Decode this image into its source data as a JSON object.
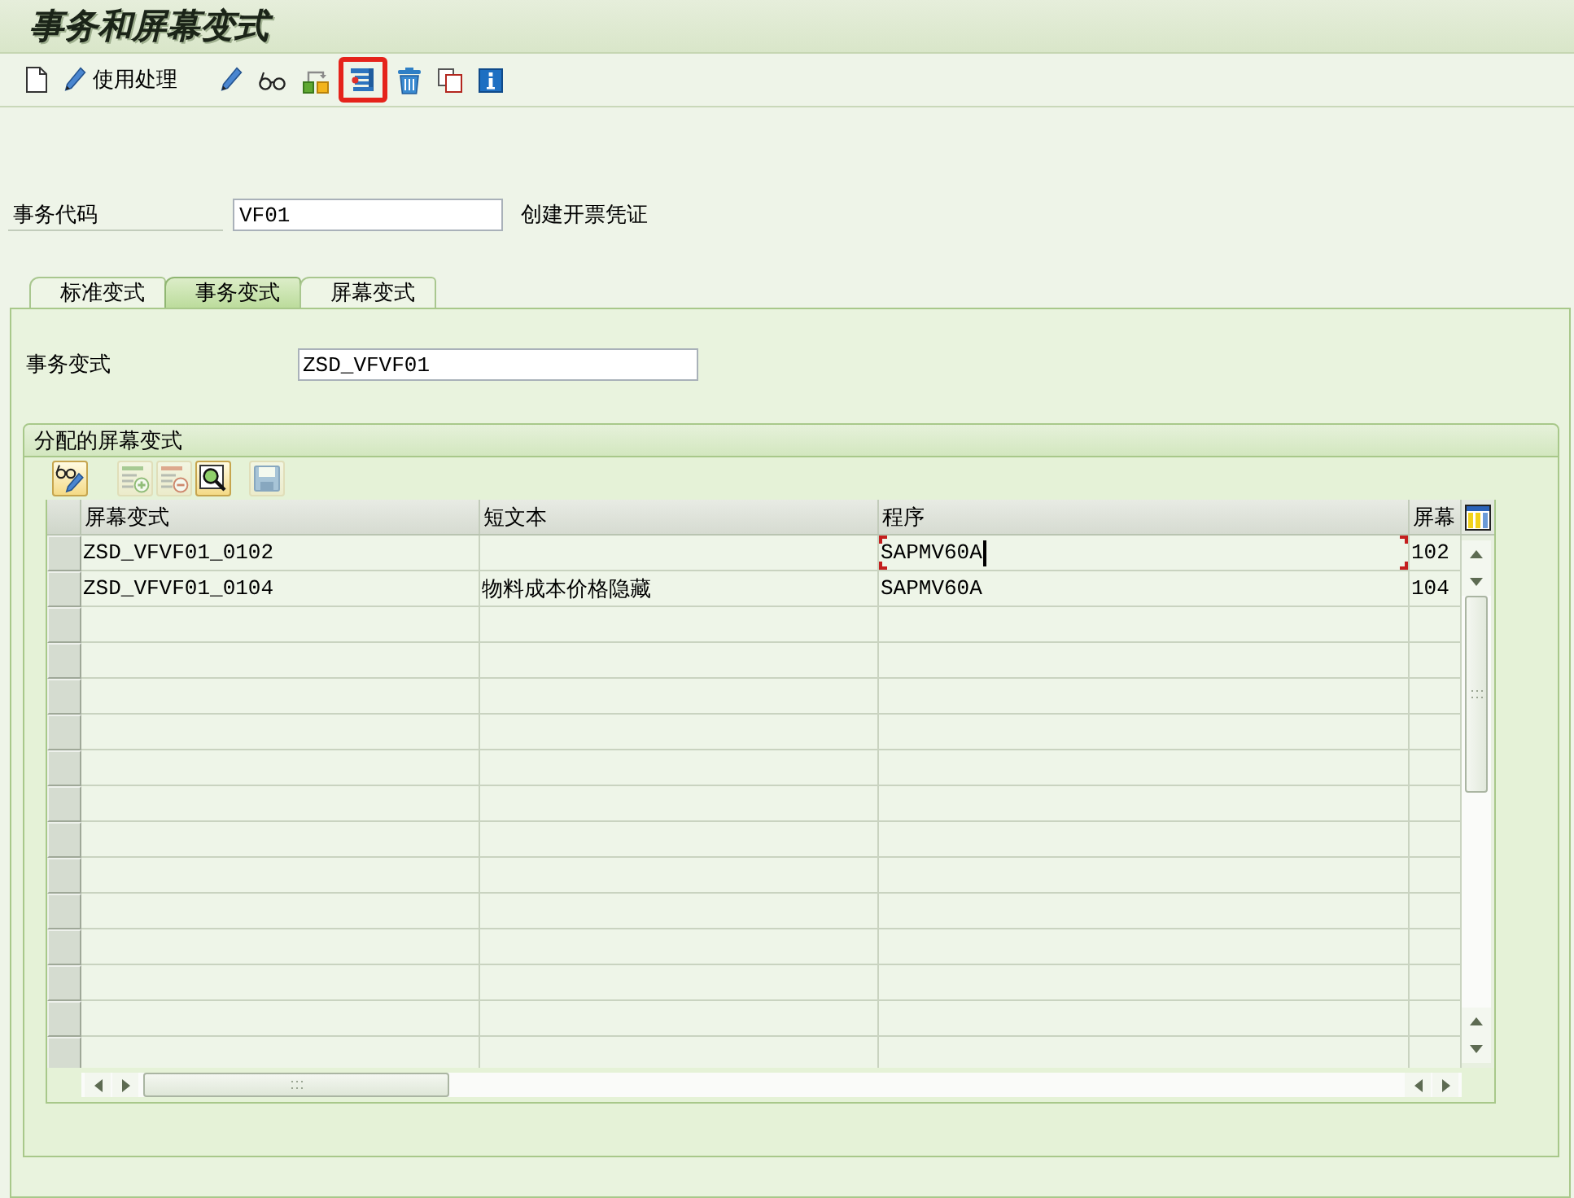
{
  "window": {
    "title": "事务和屏幕变式"
  },
  "toolbar": {
    "buttons": [
      {
        "kind": "create",
        "highlighted": false
      },
      {
        "kind": "change",
        "label": "使用处理",
        "highlighted": false
      },
      {
        "kind": "change",
        "highlighted": false
      },
      {
        "kind": "display",
        "highlighted": false
      },
      {
        "kind": "transport",
        "highlighted": false
      },
      {
        "kind": "adjust",
        "highlighted": true
      },
      {
        "kind": "delete",
        "highlighted": false
      },
      {
        "kind": "copy",
        "highlighted": false
      },
      {
        "kind": "info",
        "highlighted": false
      }
    ]
  },
  "transaction_code": {
    "label": "事务代码",
    "value": "VF01",
    "description": "创建开票凭证"
  },
  "tabs": [
    {
      "label": "标准变式",
      "selected": false
    },
    {
      "label": "事务变式",
      "selected": true
    },
    {
      "label": "屏幕变式",
      "selected": false
    }
  ],
  "transaction_variant": {
    "label": "事务变式",
    "value": "ZSD_VFVF01"
  },
  "assigned_screen_variants": {
    "title": "分配的屏幕变式",
    "toolbar": [
      {
        "kind": "toggle-edit",
        "disabled": false
      },
      {
        "kind": "insert-row",
        "disabled": true
      },
      {
        "kind": "delete-row",
        "disabled": true
      },
      {
        "kind": "find",
        "disabled": false
      },
      {
        "kind": "save",
        "disabled": true
      }
    ],
    "table": {
      "columns": [
        "屏幕变式",
        "短文本",
        "程序",
        "屏幕"
      ],
      "rows": [
        {
          "screen_variant": "ZSD_VFVF01_0102",
          "program": "SAPMV60A",
          "screen": "102",
          "focused": true
        },
        {
          "screen_variant": "ZSD_VFVF01_0104",
          "short_text": "物料成本价格隐藏",
          "program": "SAPMV60A",
          "screen": "104",
          "focused": false
        }
      ]
    }
  }
}
